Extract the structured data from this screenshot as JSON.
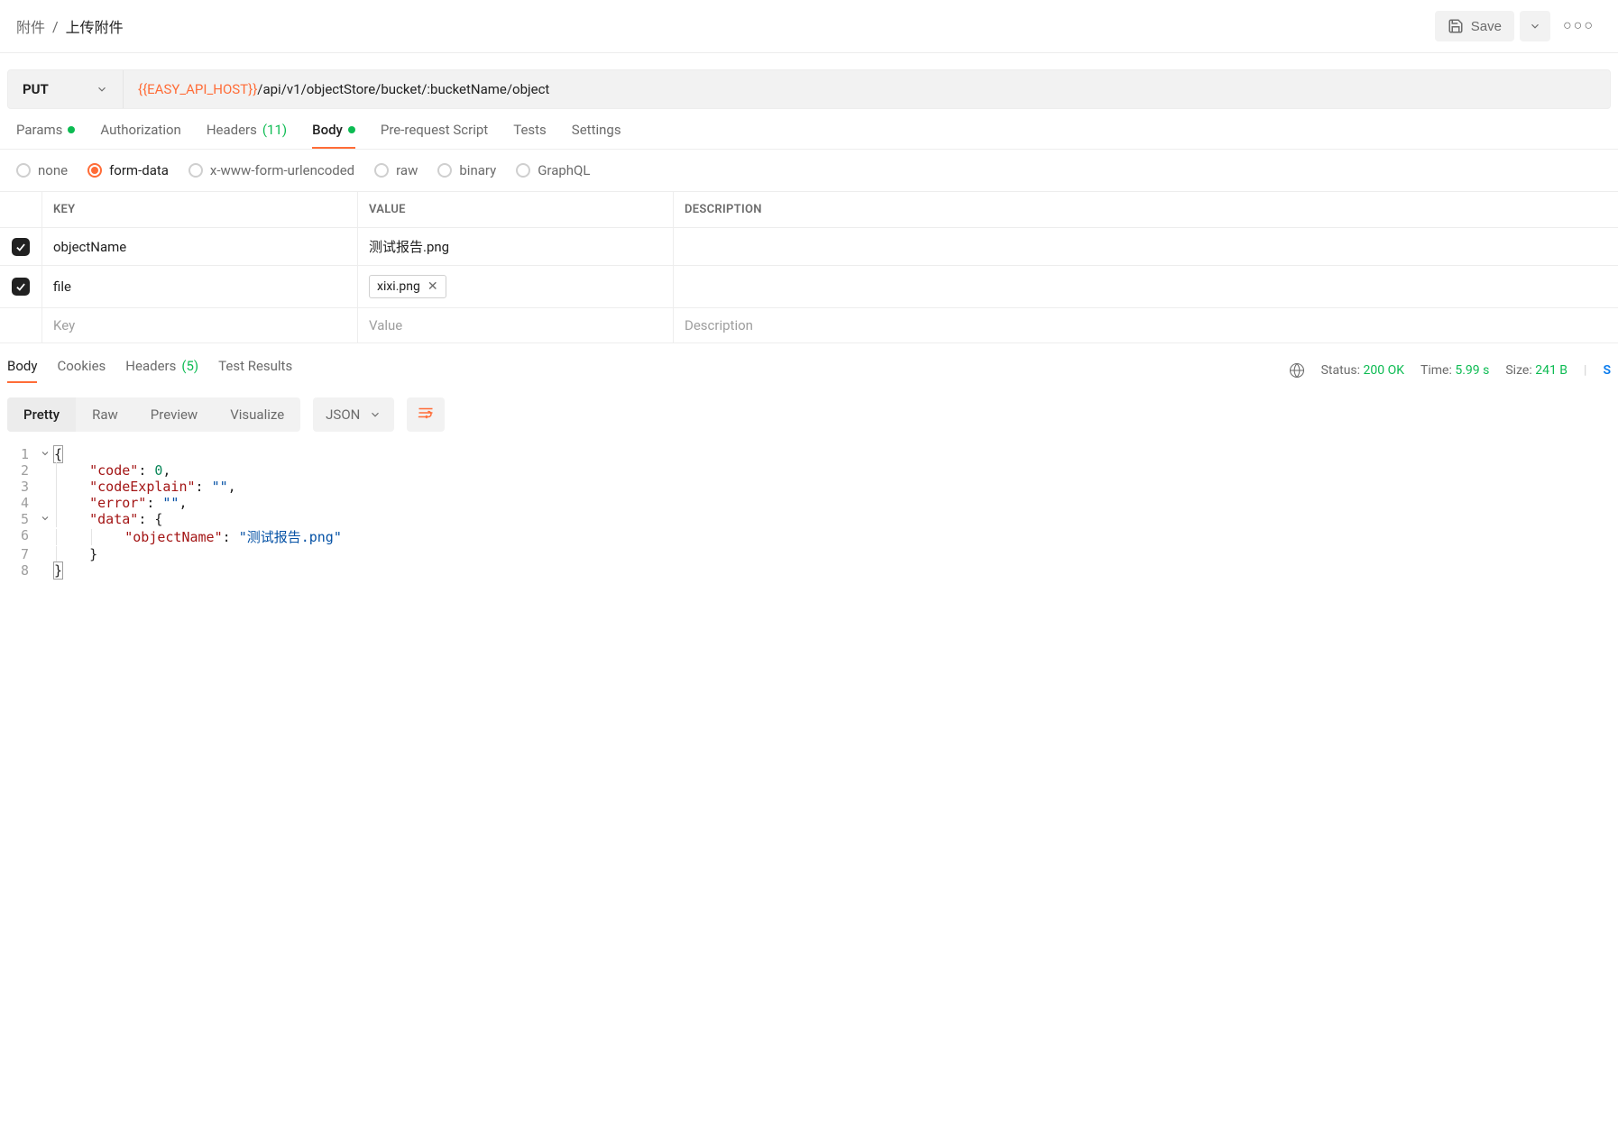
{
  "breadcrumb": {
    "parent": "附件",
    "sep": "/",
    "current": "上传附件"
  },
  "header": {
    "save_label": "Save"
  },
  "request": {
    "method": "PUT",
    "url_var": "{{EASY_API_HOST}}",
    "url_rest": "/api/v1/objectStore/bucket/:bucketName/object"
  },
  "tabs": {
    "params": "Params",
    "authorization": "Authorization",
    "headers": "Headers",
    "headers_count": "(11)",
    "body": "Body",
    "prerequest": "Pre-request Script",
    "tests": "Tests",
    "settings": "Settings"
  },
  "body_types": {
    "none": "none",
    "formdata": "form-data",
    "urlencoded": "x-www-form-urlencoded",
    "raw": "raw",
    "binary": "binary",
    "graphql": "GraphQL"
  },
  "kv": {
    "head_key": "KEY",
    "head_val": "VALUE",
    "head_desc": "DESCRIPTION",
    "rows": [
      {
        "key": "objectName",
        "value": "测试报告.png",
        "desc": ""
      },
      {
        "key": "file",
        "file": "xixi.png",
        "desc": ""
      }
    ],
    "ph_key": "Key",
    "ph_val": "Value",
    "ph_desc": "Description"
  },
  "response_tabs": {
    "body": "Body",
    "cookies": "Cookies",
    "headers": "Headers",
    "headers_count": "(5)",
    "test_results": "Test Results"
  },
  "response_meta": {
    "status_label": "Status:",
    "status_val": "200 OK",
    "time_label": "Time:",
    "time_val": "5.99 s",
    "size_label": "Size:",
    "size_val": "241 B",
    "cut": "S"
  },
  "resp_toolbar": {
    "pretty": "Pretty",
    "raw": "Raw",
    "preview": "Preview",
    "visualize": "Visualize",
    "type": "JSON"
  },
  "json_lines": {
    "l1": "{",
    "l2_key": "\"code\"",
    "l2_rest": ": ",
    "l2_num": "0",
    "l2_p": ",",
    "l3_key": "\"codeExplain\"",
    "l3_rest": ": ",
    "l3_str": "\"\"",
    "l3_p": ",",
    "l4_key": "\"error\"",
    "l4_rest": ": ",
    "l4_str": "\"\"",
    "l4_p": ",",
    "l5_key": "\"data\"",
    "l5_rest": ": {",
    "l6_key": "\"objectName\"",
    "l6_rest": ": ",
    "l6_str": "\"测试报告.png\"",
    "l7": "}",
    "l8": "}"
  },
  "line_numbers": [
    "1",
    "2",
    "3",
    "4",
    "5",
    "6",
    "7",
    "8"
  ]
}
